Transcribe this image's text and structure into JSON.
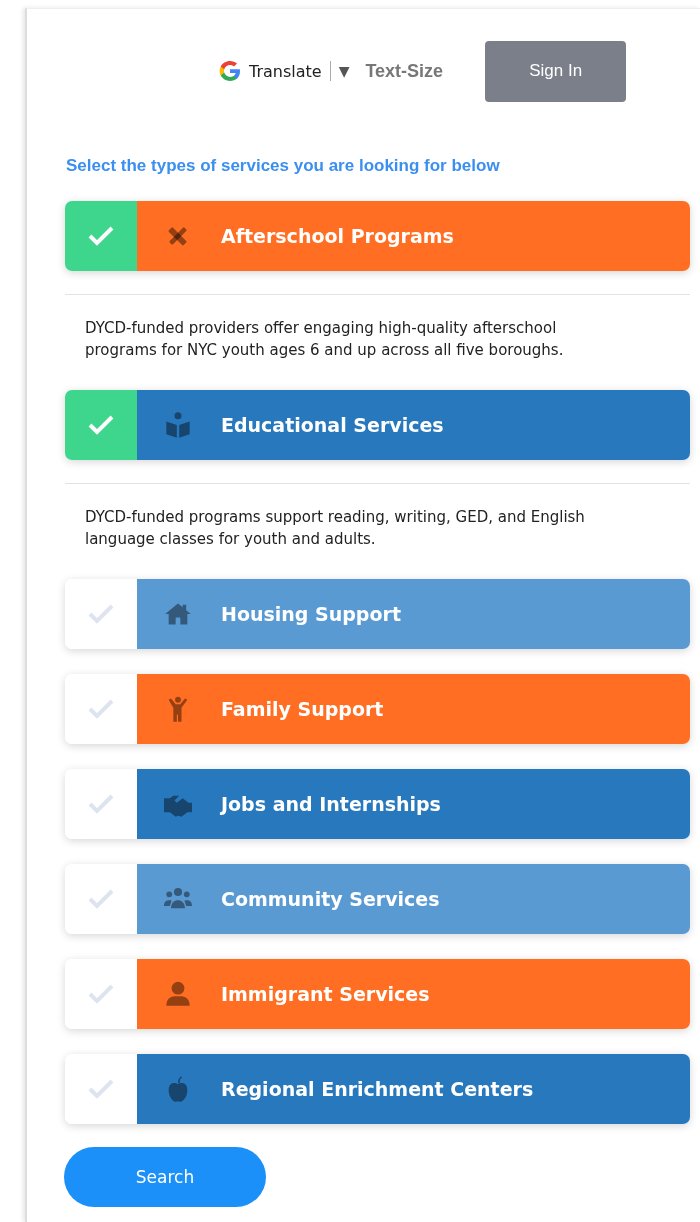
{
  "header": {
    "translate": "Translate",
    "dropdown_arrow": "▼",
    "text_size": "Text-Size",
    "sign_in": "Sign In"
  },
  "instruction": "Select the types of services you are looking for below",
  "services": [
    {
      "label": "Afterschool Programs",
      "kind": "tools",
      "color": "#ff6e22",
      "selected": true,
      "description": "DYCD-funded providers offer engaging high-quality afterschool programs for NYC youth ages 6 and up across all five boroughs."
    },
    {
      "label": "Educational Services",
      "kind": "reader",
      "color": "#2878bd",
      "selected": true,
      "description": "DYCD-funded programs support reading, writing, GED, and English language classes for youth and adults."
    },
    {
      "label": "Housing Support",
      "kind": "house",
      "color": "#5a9ad3",
      "selected": false
    },
    {
      "label": "Family Support",
      "kind": "child",
      "color": "#ff6e22",
      "selected": false
    },
    {
      "label": "Jobs and Internships",
      "kind": "handshake",
      "color": "#2878bd",
      "selected": false
    },
    {
      "label": "Community Services",
      "kind": "group",
      "color": "#5a9ad3",
      "selected": false
    },
    {
      "label": "Immigrant Services",
      "kind": "person",
      "color": "#ff6e22",
      "selected": false
    },
    {
      "label": "Regional Enrichment Centers",
      "kind": "apple",
      "color": "#2878bd",
      "selected": false
    }
  ],
  "search_button": "Search"
}
